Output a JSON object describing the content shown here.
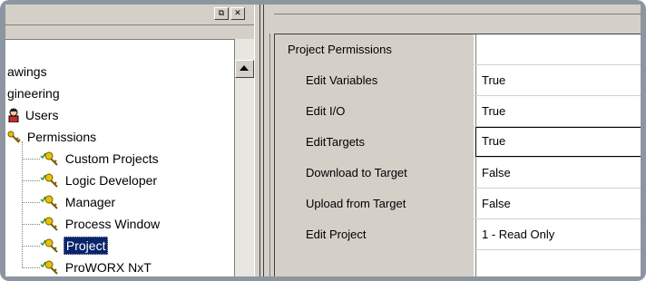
{
  "tree": {
    "items": [
      {
        "label": "awings"
      },
      {
        "label": "gineering"
      },
      {
        "label": "Users"
      },
      {
        "label": "Permissions"
      },
      {
        "label": "Custom Projects"
      },
      {
        "label": "Logic Developer"
      },
      {
        "label": "Manager"
      },
      {
        "label": "Process Window"
      },
      {
        "label": "Project"
      },
      {
        "label": "ProWORX NxT"
      }
    ],
    "selected": "Project"
  },
  "window_buttons": {
    "restore": "⧉",
    "close": "✕"
  },
  "grid": {
    "header": "Project Permissions",
    "rows": [
      {
        "name": "Edit Variables",
        "value": "True"
      },
      {
        "name": "Edit I/O",
        "value": "True"
      },
      {
        "name": "EditTargets",
        "value": "True"
      },
      {
        "name": "Download to Target",
        "value": "False"
      },
      {
        "name": "Upload from Target",
        "value": "False"
      },
      {
        "name": "Edit Project",
        "value": "1 - Read Only"
      }
    ]
  },
  "colors": {
    "frame": "#8d96a0",
    "panel": "#d4d0c8",
    "selection": "#0a246a"
  }
}
